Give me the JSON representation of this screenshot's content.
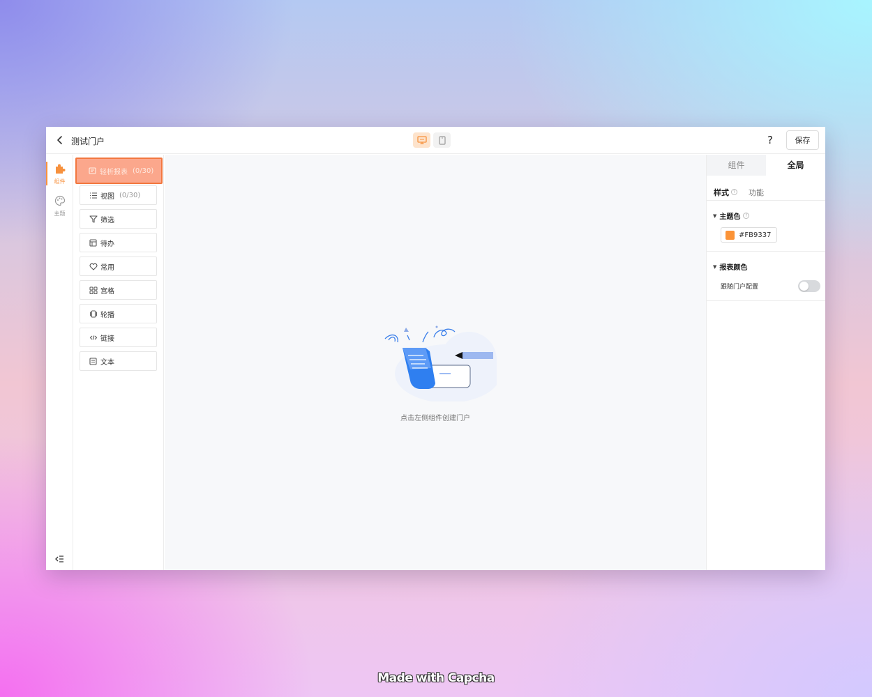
{
  "header": {
    "title": "测试门户",
    "save_label": "保存",
    "help": "?"
  },
  "rail": {
    "items": [
      {
        "label": "组件",
        "icon": "puzzle-icon",
        "active": true
      },
      {
        "label": "主题",
        "icon": "palette-icon",
        "active": false
      }
    ],
    "collapse_icon": "collapse-sidebar-icon"
  },
  "components": {
    "items": [
      {
        "label": "轻析报表",
        "count": "(0/30)",
        "icon": "report-icon"
      },
      {
        "label": "视图",
        "count": "(0/30)",
        "icon": "list-icon"
      },
      {
        "label": "筛选",
        "count": "",
        "icon": "filter-icon"
      },
      {
        "label": "待办",
        "count": "",
        "icon": "todo-icon"
      },
      {
        "label": "常用",
        "count": "",
        "icon": "heart-icon"
      },
      {
        "label": "宫格",
        "count": "",
        "icon": "grid-icon"
      },
      {
        "label": "轮播",
        "count": "",
        "icon": "carousel-icon"
      },
      {
        "label": "链接",
        "count": "",
        "icon": "code-link-icon"
      },
      {
        "label": "文本",
        "count": "",
        "icon": "text-icon"
      }
    ]
  },
  "canvas": {
    "empty_text": "点击左侧组件创建门户"
  },
  "right_panel": {
    "tabs": [
      {
        "label": "组件",
        "active": false
      },
      {
        "label": "全局",
        "active": true
      }
    ],
    "subtabs": [
      {
        "label": "样式",
        "active": true
      },
      {
        "label": "功能",
        "active": false
      }
    ],
    "theme_color": {
      "label": "主题色",
      "value": "#FB9337"
    },
    "report_color": {
      "label": "报表颜色",
      "follow_label": "跟随门户配置",
      "follow_enabled": false
    }
  },
  "watermark": "Made with Capcha",
  "colors": {
    "accent": "#f7913d",
    "theme": "#FB9337",
    "illustration_blue": "#2f7ff0"
  }
}
